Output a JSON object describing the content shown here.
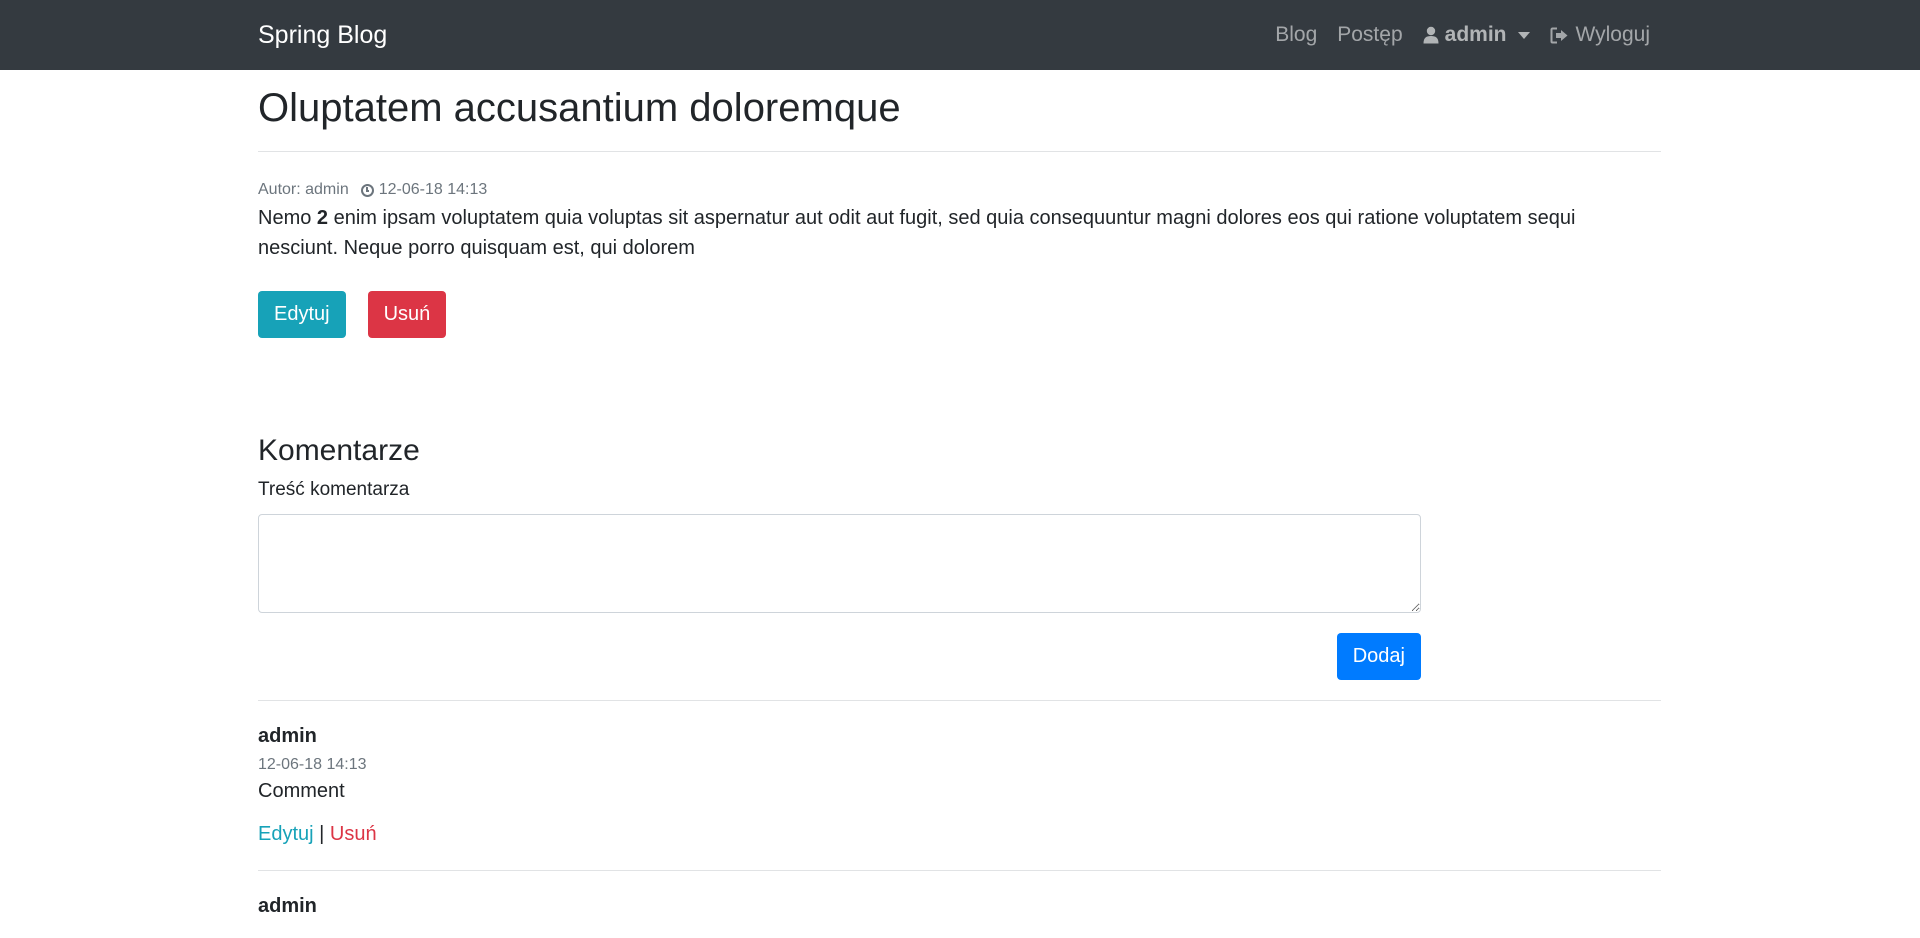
{
  "navbar": {
    "brand": "Spring Blog",
    "links": {
      "blog": "Blog",
      "progress": "Postęp",
      "user": "admin",
      "logout": "Wyloguj"
    }
  },
  "post": {
    "title": "Oluptatem accusantium doloremque",
    "author_label": "Autor: admin",
    "date": "12-06-18 14:13",
    "body_prefix": "Nemo ",
    "body_bold": "2",
    "body_rest": " enim ipsam voluptatem quia voluptas sit aspernatur aut odit aut fugit, sed quia consequuntur magni dolores eos qui ratione voluptatem sequi nesciunt. Neque porro quisquam est, qui dolorem",
    "edit_label": "Edytuj",
    "delete_label": "Usuń"
  },
  "comments": {
    "heading": "Komentarze",
    "textarea_label": "Treść komentarza",
    "textarea_value": "",
    "add_label": "Dodaj",
    "items": [
      {
        "author": "admin",
        "date": "12-06-18 14:13",
        "text": "Comment",
        "edit_label": "Edytuj",
        "separator": "|",
        "delete_label": "Usuń"
      },
      {
        "author": "admin"
      }
    ]
  },
  "colors": {
    "navbar_bg": "#343a40",
    "info": "#17a2b8",
    "danger": "#dc3545",
    "primary": "#007bff"
  },
  "icons": {
    "user": "user-icon",
    "logout": "sign-out-icon",
    "clock": "clock-icon",
    "caret": "caret-down-icon"
  }
}
